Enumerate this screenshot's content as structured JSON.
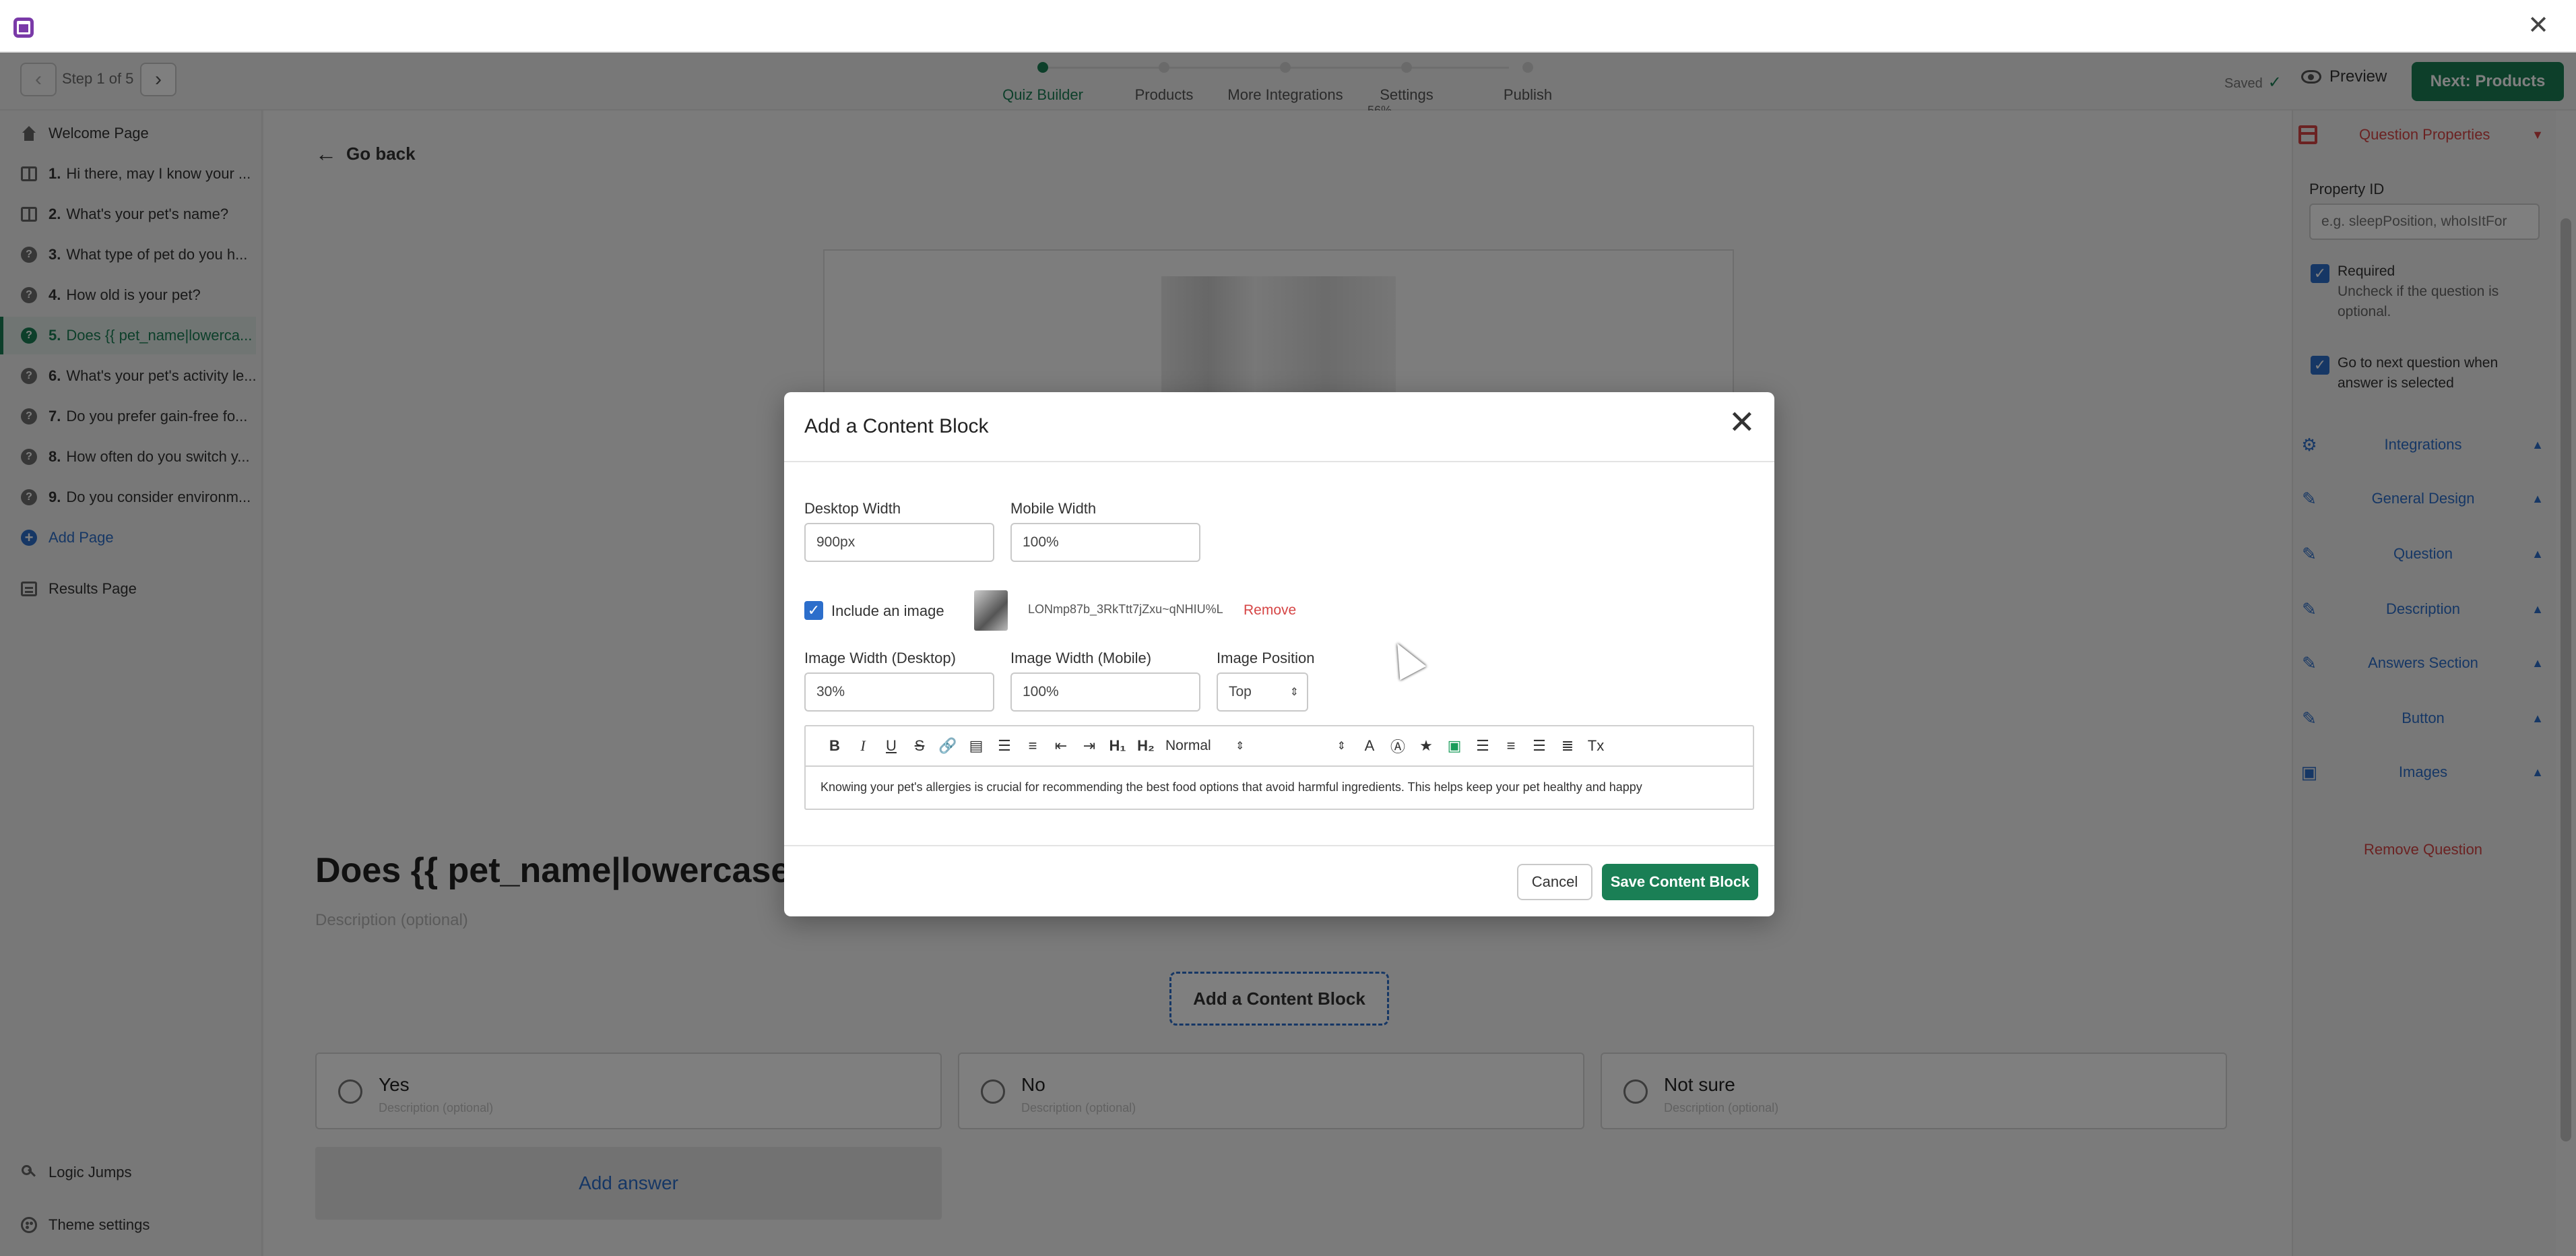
{
  "header": {
    "step_label": "Step 1 of 5",
    "steps": [
      "Quiz Builder",
      "Products",
      "More Integrations",
      "Settings",
      "Publish"
    ],
    "active_step": 0,
    "progress_text": "56%",
    "saved_label": "Saved",
    "preview_label": "Preview",
    "next_label": "Next: Products"
  },
  "sidebar": {
    "welcome": "Welcome Page",
    "questions": [
      {
        "num": "1.",
        "label": "Hi there, may I know your ..."
      },
      {
        "num": "2.",
        "label": "What's your pet's name?"
      },
      {
        "num": "3.",
        "label": "What type of pet do you h..."
      },
      {
        "num": "4.",
        "label": "How old is your pet?"
      },
      {
        "num": "5.",
        "label": "Does {{ pet_name|lowerca..."
      },
      {
        "num": "6.",
        "label": "What's your pet's activity le..."
      },
      {
        "num": "7.",
        "label": "Do you prefer gain-free fo..."
      },
      {
        "num": "8.",
        "label": "How often do you switch y..."
      },
      {
        "num": "9.",
        "label": "Do you consider environm..."
      }
    ],
    "active_index": 4,
    "add_page": "Add Page",
    "results": "Results Page",
    "logic_jumps": "Logic Jumps",
    "theme_settings": "Theme settings"
  },
  "canvas": {
    "go_back": "Go back",
    "question_title": "Does {{ pet_name|lowercase|",
    "description_placeholder": "Description (optional)",
    "add_content_block": "Add a Content Block",
    "answers": [
      {
        "label": "Yes",
        "desc": "Description (optional)"
      },
      {
        "label": "No",
        "desc": "Description (optional)"
      },
      {
        "label": "Not sure",
        "desc": "Description (optional)"
      }
    ],
    "add_answer": "Add answer"
  },
  "right_panel": {
    "header": "Question Properties",
    "property_id_label": "Property ID",
    "property_id_placeholder": "e.g. sleepPosition, whoIsItFor",
    "required_label": "Required",
    "required_sub": "Uncheck if the question is optional.",
    "next_label": "Go to next question when answer is selected",
    "sections": [
      "Integrations",
      "General Design",
      "Question",
      "Description",
      "Answers Section",
      "Button",
      "Images"
    ],
    "remove_question": "Remove Question"
  },
  "modal": {
    "title": "Add a Content Block",
    "desktop_width_label": "Desktop Width",
    "desktop_width_value": "900px",
    "mobile_width_label": "Mobile Width",
    "mobile_width_value": "100%",
    "include_image_label": "Include an image",
    "image_filename": "LONmp87b_3RkTtt7jZxu~qNHIU%L",
    "remove_label": "Remove",
    "img_width_desktop_label": "Image Width (Desktop)",
    "img_width_desktop_value": "30%",
    "img_width_mobile_label": "Image Width (Mobile)",
    "img_width_mobile_value": "100%",
    "img_position_label": "Image Position",
    "img_position_value": "Top",
    "format_value": "Normal",
    "editor_text": "Knowing your pet's allergies is crucial for recommending the best food options that avoid harmful ingredients. This helps keep your pet healthy and happy",
    "cancel_label": "Cancel",
    "save_label": "Save Content Block"
  },
  "colors": {
    "brand_green": "#1a7f55",
    "link_blue": "#2c6ecb",
    "danger_red": "#d64545"
  }
}
